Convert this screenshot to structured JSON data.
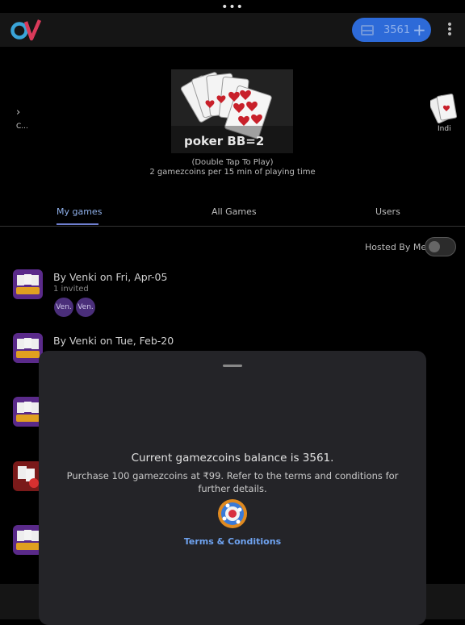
{
  "header": {
    "coins": "3561",
    "plus": "+",
    "more": "⋮",
    "top_dots": "•••"
  },
  "carousel": {
    "left_chevron": "›",
    "left_label": "C...",
    "featured_title": "poker BB=2",
    "right_label": "Indi",
    "tap_hint": "(Double Tap To Play)",
    "coin_rate": "2 gamezcoins per 15 min of playing time"
  },
  "tabs": [
    "My games",
    "All Games",
    "Users"
  ],
  "filter": {
    "hosted_label": "Hosted By Me",
    "hosted_on": false
  },
  "games": [
    {
      "title": "By Venki on Fri, Apr-05",
      "sub": "1 invited",
      "avatars": [
        "Ven.",
        "Ven."
      ]
    },
    {
      "title": "By Venki on Tue, Feb-20"
    }
  ],
  "sheet": {
    "balance": "Current gamezcoins balance is 3561.",
    "purchase": "Purchase 100 gamezcoins at ₹99. Refer to the terms and conditions for further details.",
    "terms": "Terms & Conditions"
  },
  "colors": {
    "accent": "#2d6ad8",
    "link": "#6fa3f0",
    "sheet_bg": "#242428"
  }
}
